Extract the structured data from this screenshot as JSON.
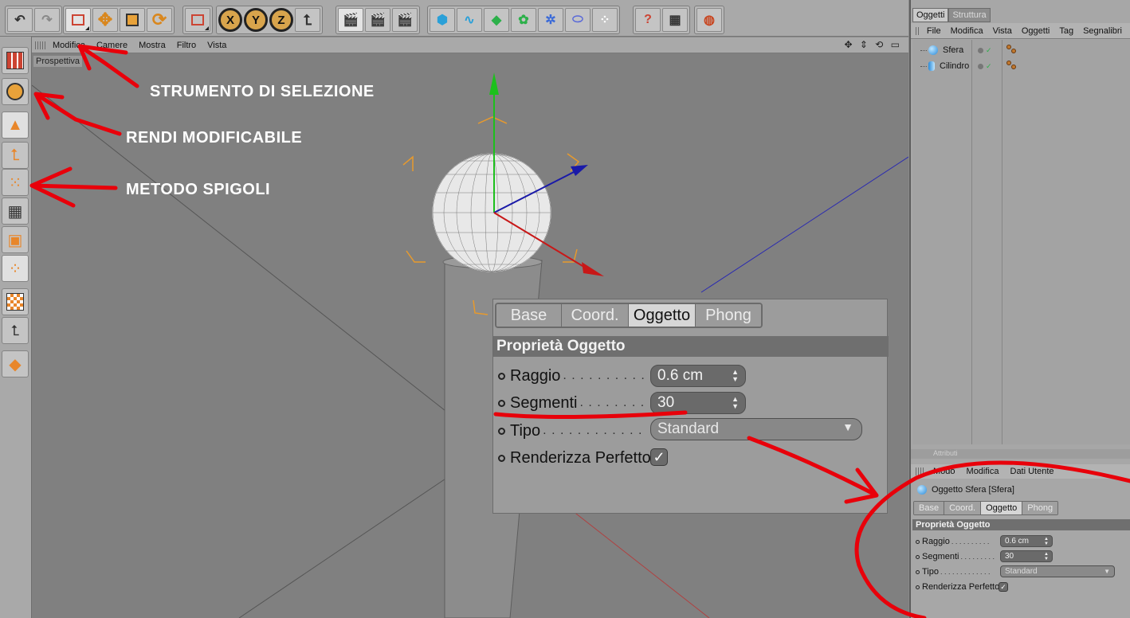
{
  "viewport": {
    "menu": [
      "Modifica",
      "Camere",
      "Mostra",
      "Filtro",
      "Vista"
    ],
    "nav_icons": "✥ ⇕ ⟲ ▭",
    "label": "Prospettiva"
  },
  "annotations": {
    "selection_tool": "STRUMENTO DI SELEZIONE",
    "make_editable": "RENDI MODIFICABILE",
    "edges_mode": "METODO SPIGOLI"
  },
  "objects_panel": {
    "tabs": [
      "Oggetti",
      "Struttura"
    ],
    "menu": [
      "File",
      "Modifica",
      "Vista",
      "Oggetti",
      "Tag",
      "Segnalibri"
    ],
    "items": [
      {
        "name": "Sfera",
        "icon": "sphere-icon"
      },
      {
        "name": "Cilindro",
        "icon": "cylinder-icon"
      }
    ]
  },
  "attributes_panel": {
    "header": "Attributi",
    "menu": [
      "Modo",
      "Modifica",
      "Dati Utente"
    ],
    "object_title": "Oggetto Sfera [Sfera]",
    "tabs": [
      "Base",
      "Coord.",
      "Oggetto",
      "Phong"
    ],
    "active_tab": "Oggetto",
    "section": "Proprietà Oggetto",
    "fields": {
      "radius_label": "Raggio",
      "radius_value": "0.6 cm",
      "segments_label": "Segmenti",
      "segments_value": "30",
      "type_label": "Tipo",
      "type_value": "Standard",
      "render_perfect_label": "Renderizza Perfetto",
      "render_perfect_checked": true
    }
  },
  "overlay_zoom": {
    "tabs": [
      "Base",
      "Coord.",
      "Oggetto",
      "Phong"
    ],
    "section": "Proprietà Oggetto",
    "radius_label": "Raggio",
    "radius_value": "0.6 cm",
    "segments_label": "Segmenti",
    "segments_value": "30",
    "type_label": "Tipo",
    "type_value": "Standard",
    "render_perfect_label": "Renderizza Perfetto"
  },
  "colors": {
    "annotation_red": "#e8000a",
    "accent_orange": "#e89a2c",
    "axis_green": "#1cc01c",
    "axis_blue": "#1a1aa8",
    "axis_red": "#c81818"
  }
}
